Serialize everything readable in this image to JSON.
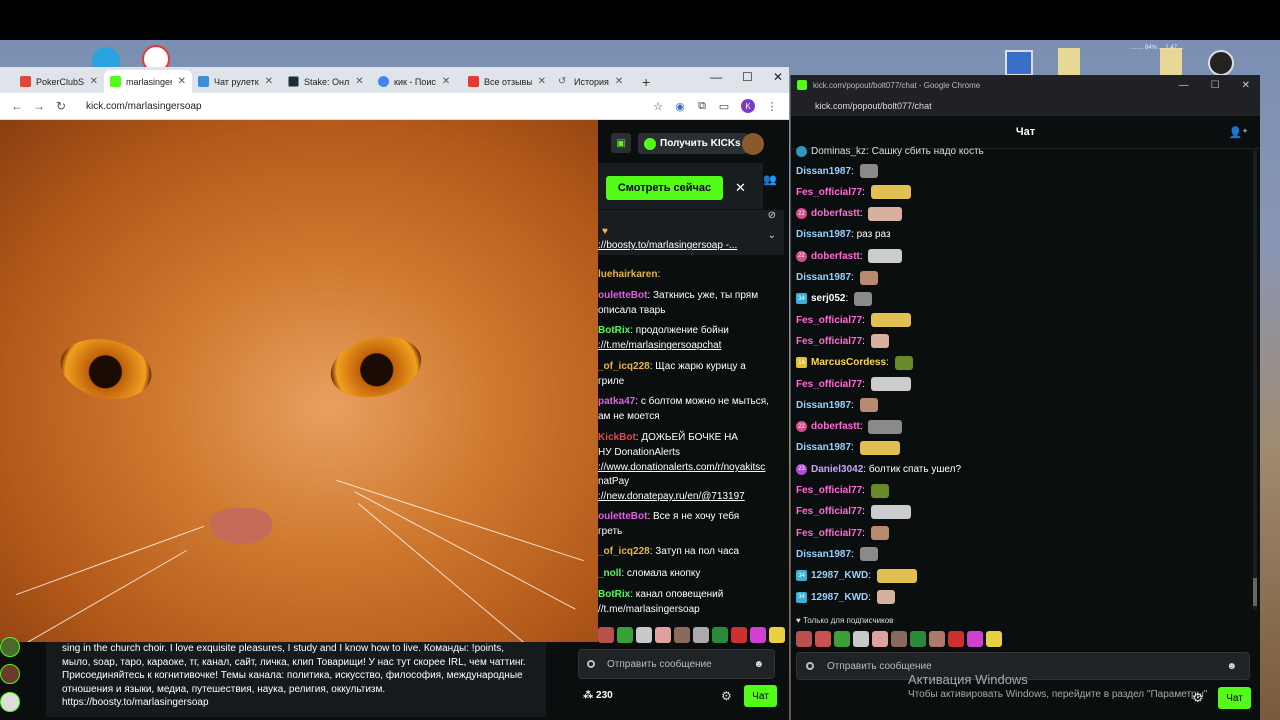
{
  "main_browser": {
    "tabs": [
      {
        "label": "PokerClubS",
        "color": "#e0443a"
      },
      {
        "label": "marlasinger",
        "color": "#53fc18"
      },
      {
        "label": "Чат рулетк",
        "color": "#3a8fd8"
      },
      {
        "label": "Stake: Онл",
        "color": "#1a2c38"
      },
      {
        "label": "кик - Поис",
        "color": "#4285f4"
      },
      {
        "label": "Все отзывы",
        "color": "#e53935"
      },
      {
        "label": "История",
        "color": "#5f6368"
      }
    ],
    "url": "kick.com/marlasingersoap",
    "profile_letter": "K"
  },
  "kick": {
    "get_kicks_label": "Получить KICKs",
    "watch_now_label": "Смотреть сейчас",
    "pinned_link": "://boosty.to/marlasingersoap -...",
    "viewer_count": "230",
    "input_placeholder": "Отправить сообщение",
    "chat_button": "Чат"
  },
  "mid_chat": [
    {
      "user": "luehairkaren",
      "color": "#e8b44a",
      "text": ""
    },
    {
      "user": "ouletteBot",
      "color": "#e35ee3",
      "text": "Заткнись уже, ты прям"
    },
    {
      "user": "",
      "color": "#fff",
      "text": "описала тварь"
    },
    {
      "user": "BotRix",
      "color": "#5cf75c",
      "text": "продолжение бойни"
    },
    {
      "user": "",
      "color": "#fff",
      "text": "://t.me/marlasingersoapchat",
      "link": true
    },
    {
      "user": "_of_icq228",
      "color": "#e8b44a",
      "text": "Щас жарю курицу а"
    },
    {
      "user": "",
      "color": "#fff",
      "text": "гриле"
    },
    {
      "user": "patka47",
      "color": "#e35ee3",
      "text": "с болтом можно не мыться,"
    },
    {
      "user": "",
      "color": "#fff",
      "text": "ам не моется"
    },
    {
      "user": "KickBot",
      "color": "#e5484d",
      "text": "ДОЖЬЕЙ БОЧКЕ НА"
    },
    {
      "user": "",
      "color": "#fff",
      "text": "НУ   DonationAlerts"
    },
    {
      "user": "",
      "color": "#fff",
      "text": "://www.donationalerts.com/r/noyakitsc",
      "link": true
    },
    {
      "user": "",
      "color": "#fff",
      "text": "natPay"
    },
    {
      "user": "",
      "color": "#fff",
      "text": "://new.donatepay.ru/en/@713197",
      "link": true
    },
    {
      "user": "ouletteBot",
      "color": "#e35ee3",
      "text": "Все я не хочу тебя"
    },
    {
      "user": "",
      "color": "#fff",
      "text": "греть"
    },
    {
      "user": "_of_icq228",
      "color": "#e8b44a",
      "text": "Затуп на пол часа"
    },
    {
      "user": "_noll",
      "color": "#5cf75c",
      "text": "сломала кнопку"
    },
    {
      "user": "BotRix",
      "color": "#5cf75c",
      "text": "канал оповещений"
    },
    {
      "user": "",
      "color": "#fff",
      "text": "//t.me/marlasingersoap"
    }
  ],
  "about": {
    "lines": [
      "sing in the church choir. I love exquisite pleasures, I study and I know how to live. Команды: !points,",
      "мыло, soap, таро, караоке, тг, канал, сайт, личка, клип Товарищи! У нас тут скорее IRL, чем чаттинг.",
      "Присоединяйтесь к когнитивочке! Темы канала: политика, искусство, философия, международные",
      "отношения и языки, медиа, путешествия, наука, религия, оккультизм.",
      "https://boosty.to/marlasingersoap"
    ]
  },
  "popout": {
    "title": "kick.com/popout/bolt077/chat - Google Chrome",
    "url": "kick.com/popout/bolt077/chat",
    "header": "Чат",
    "top_partial": "Dominas_kz: Сашку сбить надо кость",
    "messages": [
      {
        "user": "Dissan1987",
        "color": "#9ad0ff",
        "text": ""
      },
      {
        "user": "Fes_official77",
        "color": "#ff6ad5",
        "text": ""
      },
      {
        "user": "doberfastt",
        "color": "#ff6ad5",
        "text": "",
        "badge": "22"
      },
      {
        "user": "Dissan1987",
        "color": "#9ad0ff",
        "text": "раз раз"
      },
      {
        "user": "doberfastt",
        "color": "#ff6ad5",
        "text": "",
        "badge": "22"
      },
      {
        "user": "Dissan1987",
        "color": "#9ad0ff",
        "text": ""
      },
      {
        "user": "serj052",
        "color": "#ffffff",
        "text": "",
        "badge": "34"
      },
      {
        "user": "Fes_official77",
        "color": "#ff6ad5",
        "text": ""
      },
      {
        "user": "Fes_official77",
        "color": "#ff6ad5",
        "text": ""
      },
      {
        "user": "MarcusCordess",
        "color": "#ffd84a",
        "text": "",
        "badge": "14"
      },
      {
        "user": "Fes_official77",
        "color": "#ff6ad5",
        "text": ""
      },
      {
        "user": "Dissan1987",
        "color": "#9ad0ff",
        "text": ""
      },
      {
        "user": "doberfastt",
        "color": "#ff6ad5",
        "text": "",
        "badge": "22"
      },
      {
        "user": "Dissan1987",
        "color": "#9ad0ff",
        "text": ""
      },
      {
        "user": "Daniel3042",
        "color": "#c9a4ff",
        "text": "болтик спать ушел?",
        "badge": "23"
      },
      {
        "user": "Fes_official77",
        "color": "#ff6ad5",
        "text": ""
      },
      {
        "user": "Fes_official77",
        "color": "#ff6ad5",
        "text": ""
      },
      {
        "user": "Fes_official77",
        "color": "#ff6ad5",
        "text": ""
      },
      {
        "user": "Dissan1987",
        "color": "#9ad0ff",
        "text": ""
      },
      {
        "user": "12987_KWD",
        "color": "#9ad0ff",
        "text": "",
        "badge": "34"
      },
      {
        "user": "12987_KWD",
        "color": "#9ad0ff",
        "text": "",
        "badge": "34"
      }
    ],
    "sub_only": "Только для подписчиков",
    "input_placeholder": "Отправить сообщение",
    "chat_button": "Чат"
  },
  "activation": {
    "line1": "Активация Windows",
    "line2": "Чтобы активировать Windows, перейдите в раздел \"Параметры\""
  },
  "desktop_tray_text": "........ 84% ...  1.47 ...",
  "accent": "#53fc18"
}
